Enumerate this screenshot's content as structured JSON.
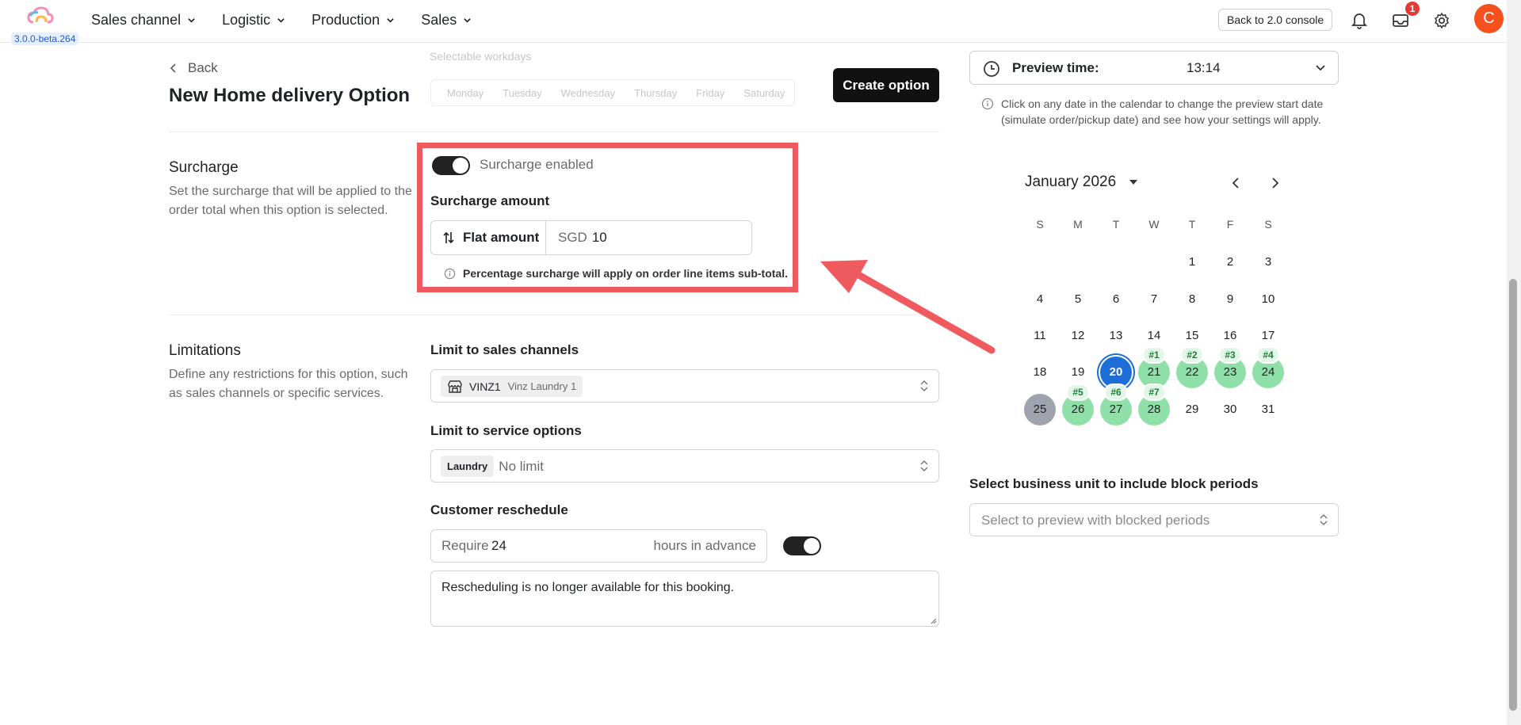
{
  "app": {
    "version": "3.0.0-beta.264",
    "back_console": "Back to 2.0 console",
    "notifications_count": "1",
    "avatar_initial": "C"
  },
  "nav": {
    "items": [
      {
        "label": "Sales channel"
      },
      {
        "label": "Logistic"
      },
      {
        "label": "Production"
      },
      {
        "label": "Sales"
      }
    ]
  },
  "faded_bg": {
    "selectable_workdays": "Selectable workdays",
    "days": [
      "Monday",
      "Tuesday",
      "Wednesday",
      "Thursday",
      "Friday",
      "Saturday"
    ]
  },
  "header": {
    "back_label": "Back",
    "title": "New Home delivery Option",
    "create_button": "Create option"
  },
  "surcharge": {
    "section_title": "Surcharge",
    "section_desc": "Set the surcharge that will be applied to the order total when this option is selected.",
    "enabled_label": "Surcharge enabled",
    "enabled": true,
    "amount_label": "Surcharge amount",
    "type_label": "Flat amount",
    "currency": "SGD",
    "amount_value": "10",
    "note": "Percentage surcharge will apply on order line items sub-total."
  },
  "limitations": {
    "section_title": "Limitations",
    "section_desc": "Define any restrictions for this option, such as sales channels or specific services.",
    "sales_channels_label": "Limit to sales channels",
    "sales_channel_code": "VINZ1",
    "sales_channel_name": "Vinz Laundry 1",
    "service_options_label": "Limit to service options",
    "service_chip": "Laundry",
    "service_value": "No limit",
    "reschedule_label": "Customer reschedule",
    "require_prefix": "Require",
    "require_hours": "24",
    "require_suffix": "hours in advance",
    "reschedule_enabled": true,
    "reschedule_message": "Rescheduling is no longer available for this booking."
  },
  "preview": {
    "label": "Preview time:",
    "time": "13:14",
    "hint": "Click on any date in the calendar to change the preview start date (simulate order/pickup date) and see how your settings will apply.",
    "month": "January 2026",
    "weekdays": [
      "S",
      "M",
      "T",
      "W",
      "T",
      "F",
      "S"
    ],
    "days": [
      "1",
      "2",
      "3",
      "4",
      "5",
      "6",
      "7",
      "8",
      "9",
      "10",
      "11",
      "12",
      "13",
      "14",
      "15",
      "16",
      "17",
      "18",
      "19",
      "20",
      "21",
      "22",
      "23",
      "24",
      "25",
      "26",
      "27",
      "28",
      "29",
      "30",
      "31"
    ],
    "today": "20",
    "selected_start": "25",
    "highlighted": [
      {
        "day": "21",
        "tag": "#1"
      },
      {
        "day": "22",
        "tag": "#2"
      },
      {
        "day": "23",
        "tag": "#3"
      },
      {
        "day": "24",
        "tag": "#4"
      },
      {
        "day": "26",
        "tag": "#5"
      },
      {
        "day": "27",
        "tag": "#6"
      },
      {
        "day": "28",
        "tag": "#7"
      }
    ],
    "business_unit_label": "Select business unit to include block periods",
    "business_unit_placeholder": "Select to preview with blocked periods"
  }
}
